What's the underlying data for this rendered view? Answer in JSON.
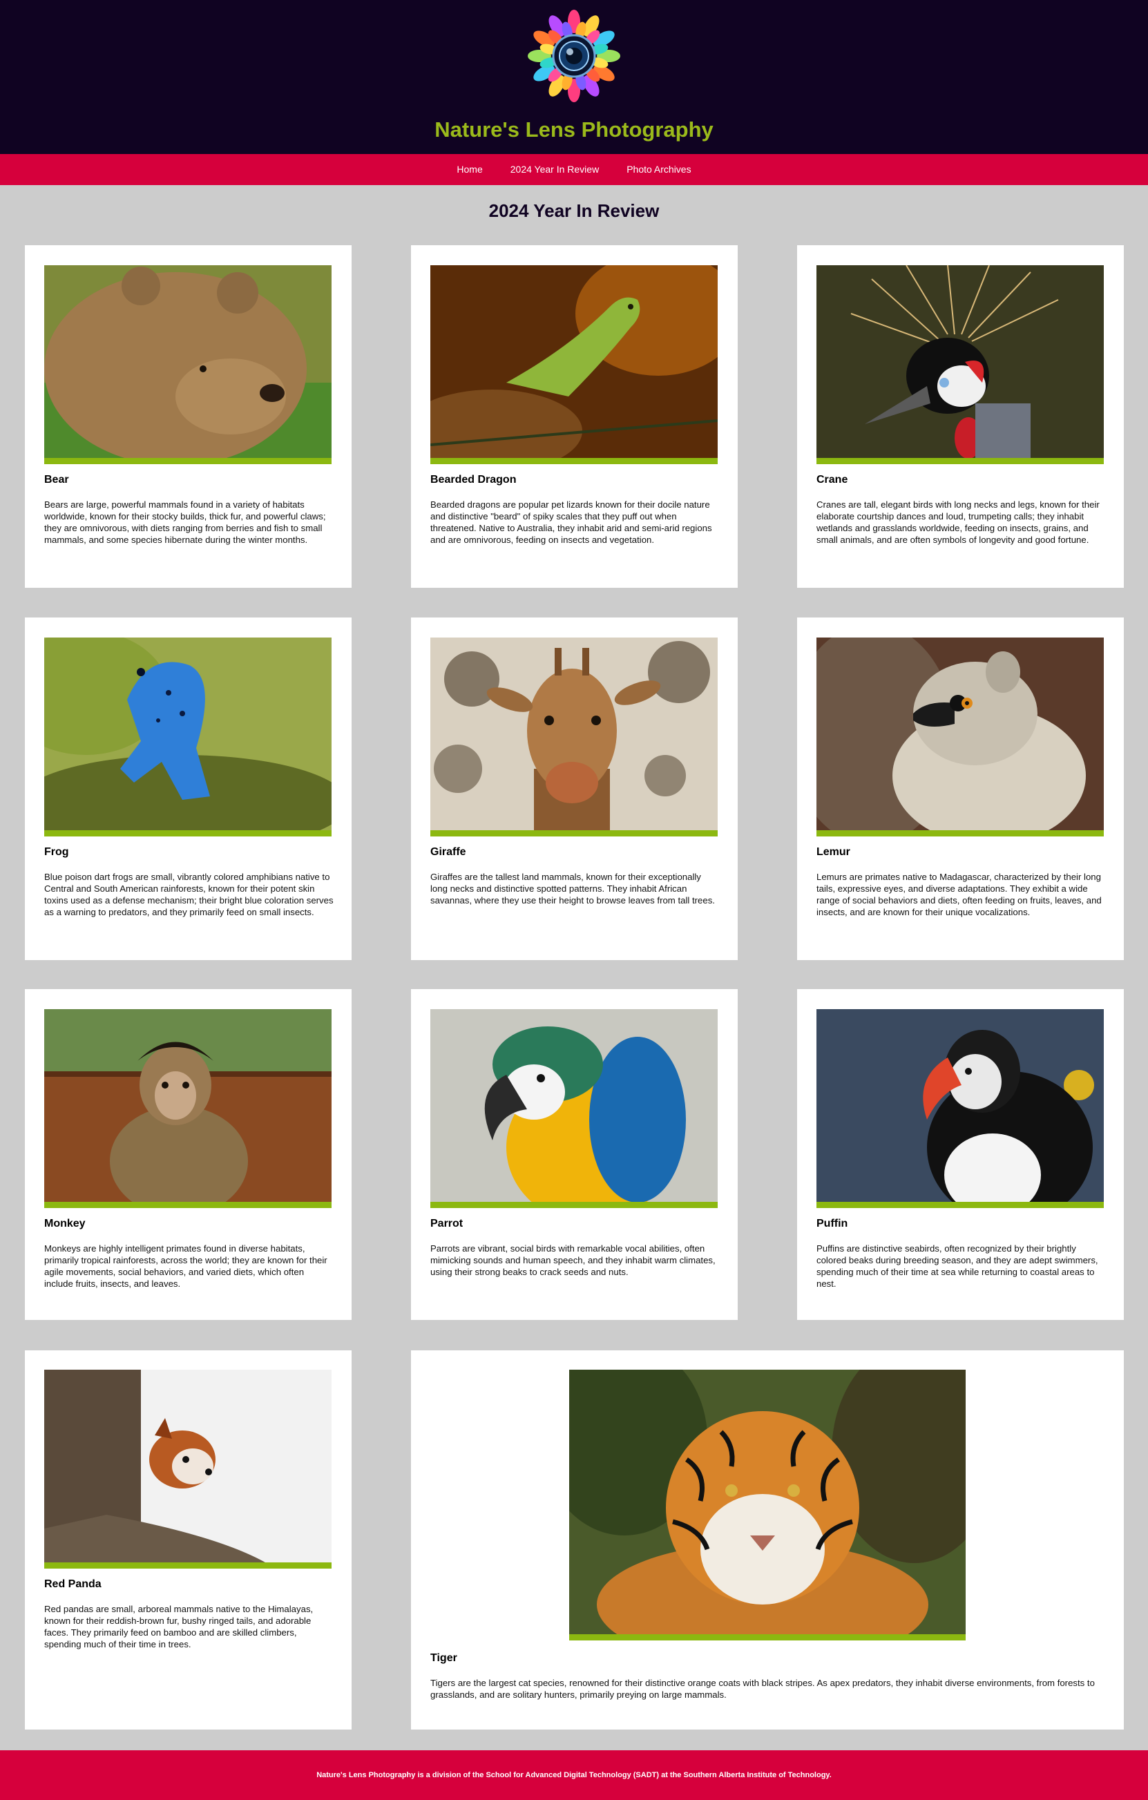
{
  "header": {
    "site_title": "Nature's Lens Photography",
    "logo_icon": "camera-lens-flower-icon"
  },
  "nav": {
    "items": [
      {
        "label": "Home"
      },
      {
        "label": "2024 Year In Review"
      },
      {
        "label": "Photo Archives"
      }
    ]
  },
  "main": {
    "heading": "2024 Year In Review",
    "accent_color": "#8cb810",
    "cards": [
      {
        "name": "Bear",
        "description": "Bears are large, powerful mammals found in a variety of habitats worldwide, known for their stocky builds, thick fur, and powerful claws; they are omnivorous, with diets ranging from berries and fish to small mammals, and some species hibernate during the winter months."
      },
      {
        "name": "Bearded Dragon",
        "description": "Bearded dragons are popular pet lizards known for their docile nature and distinctive \"beard\" of spiky scales that they puff out when threatened. Native to Australia, they inhabit arid and semi-arid regions and are omnivorous, feeding on insects and vegetation."
      },
      {
        "name": "Crane",
        "description": "Cranes are tall, elegant birds with long necks and legs, known for their elaborate courtship dances and loud, trumpeting calls; they inhabit wetlands and grasslands worldwide, feeding on insects, grains, and small animals, and are often symbols of longevity and good fortune."
      },
      {
        "name": "Frog",
        "description": "Blue poison dart frogs are small, vibrantly colored amphibians native to Central and South American rainforests, known for their potent skin toxins used as a defense mechanism; their bright blue coloration serves as a warning to predators, and they primarily feed on small insects."
      },
      {
        "name": "Giraffe",
        "description": "Giraffes are the tallest land mammals, known for their exceptionally long necks and distinctive spotted patterns. They inhabit African savannas, where they use their height to browse leaves from tall trees."
      },
      {
        "name": "Lemur",
        "description": "Lemurs are primates native to Madagascar, characterized by their long tails, expressive eyes, and diverse adaptations. They exhibit a wide range of social behaviors and diets, often feeding on fruits, leaves, and insects, and are known for their unique vocalizations."
      },
      {
        "name": "Monkey",
        "description": "Monkeys are highly intelligent primates found in diverse habitats, primarily tropical rainforests, across the world; they are known for their agile movements, social behaviors, and varied diets, which often include fruits, insects, and leaves."
      },
      {
        "name": "Parrot",
        "description": "Parrots are vibrant, social birds with remarkable vocal abilities, often mimicking sounds and human speech, and they inhabit warm climates, using their strong beaks to crack seeds and nuts."
      },
      {
        "name": "Puffin",
        "description": "Puffins are distinctive seabirds, often recognized by their brightly colored beaks during breeding season, and they are adept swimmers, spending much of their time at sea while returning to coastal areas to nest."
      },
      {
        "name": "Red Panda",
        "description": "Red pandas are small, arboreal mammals native to the Himalayas, known for their reddish-brown fur, bushy ringed tails, and adorable faces. They primarily feed on bamboo and are skilled climbers, spending much of their time in trees."
      },
      {
        "name": "Tiger",
        "description": "Tigers are the largest cat species, renowned for their distinctive orange coats with black stripes. As apex predators, they inhabit diverse environments, from forests to grasslands, and are solitary hunters, primarily preying on large mammals."
      }
    ]
  },
  "footer": {
    "text": "Nature's Lens Photography is a division of the School for Advanced Digital Technology (SADT) at the Southern Alberta Institute of Technology."
  }
}
